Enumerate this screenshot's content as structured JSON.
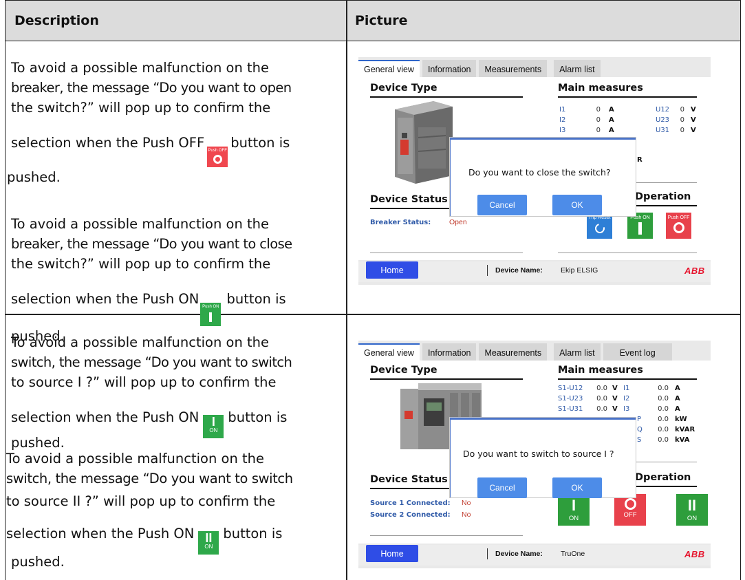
{
  "table": {
    "header": {
      "description": "Description",
      "picture": "Picture"
    }
  },
  "row1": {
    "para1": {
      "l1": "To avoid a possible malfunction on the",
      "l2": "breaker, the message “Do you want to open",
      "l3": "the switch?” will pop up to confirm the",
      "l4a": "selection when the Push OFF",
      "l4b": "button is",
      "l5": "pushed.",
      "btn_label": "Push OFF"
    },
    "para2": {
      "l1": "To avoid a possible malfunction on the",
      "l2": "breaker, the message “Do you want to close",
      "l3": "the switch?” will pop up to confirm the",
      "l4a": "selection when the Push ON",
      "l4b": "button is",
      "l5": "pushed.",
      "btn_label": "Push ON"
    },
    "screen": {
      "tabs": [
        "General view",
        "Information",
        "Measurements",
        "Alarm list"
      ],
      "device_type": "Device Type",
      "main_measures": "Main measures",
      "measures": [
        {
          "label": "I1",
          "value": "0",
          "unit": "A"
        },
        {
          "label": "I2",
          "value": "0",
          "unit": "A"
        },
        {
          "label": "I3",
          "value": "0",
          "unit": "A"
        }
      ],
      "measures_right": [
        {
          "label": "U12",
          "value": "0",
          "unit": "V"
        },
        {
          "label": "U23",
          "value": "0",
          "unit": "V"
        },
        {
          "label": "U31",
          "value": "0",
          "unit": "V"
        }
      ],
      "partial_r": "R",
      "device_status": "Device Status",
      "operation": "Operation",
      "operation_visible": "Dperation",
      "breaker_status_label": "Breaker Status:",
      "breaker_status_value": "Open",
      "trip_reset_label": "Trip Reset",
      "push_on_label": "Push ON",
      "push_off_label": "Push OFF",
      "dialog_text": "Do you want to close the switch?",
      "cancel": "Cancel",
      "ok": "OK",
      "home": "Home",
      "device_name_label": "Device Name:",
      "device_name_value": "Ekip ELSIG",
      "logo": "ABB"
    }
  },
  "row2": {
    "para1": {
      "l1": "To avoid a possible malfunction on the",
      "l2": "switch, the message “Do you want to switch",
      "l3": "to source Ι ?” will pop up to confirm the",
      "l4a": "selection when the Push ON",
      "l4b": "button is",
      "l5": "pushed.",
      "btn_symbol": "I",
      "btn_sub": "ON"
    },
    "para2": {
      "l1": "To avoid a possible malfunction on the",
      "l2": "switch, the message “Do you want to switch",
      "l3": "to source II ?” will pop up to confirm the",
      "l4a": "selection when the Push ON",
      "l4b": "button is",
      "l5": "pushed.",
      "btn_symbol": "II",
      "btn_sub": "ON"
    },
    "screen": {
      "tabs": [
        "General view",
        "Information",
        "Measurements",
        "Alarm list",
        "Event log"
      ],
      "device_type": "Device Type",
      "main_measures": "Main measures",
      "measures_left": [
        {
          "label": "S1-U12",
          "value": "0.0",
          "unit": "V"
        },
        {
          "label": "S1-U23",
          "value": "0.0",
          "unit": "V"
        },
        {
          "label": "S1-U31",
          "value": "0.0",
          "unit": "V"
        }
      ],
      "measures_right": [
        {
          "label": "I1",
          "value": "0.0",
          "unit": "A"
        },
        {
          "label": "I2",
          "value": "0.0",
          "unit": "A"
        },
        {
          "label": "I3",
          "value": "0.0",
          "unit": "A"
        },
        {
          "label": "P",
          "value": "0.0",
          "unit": "kW"
        },
        {
          "label": "Q",
          "value": "0.0",
          "unit": "kVAR"
        },
        {
          "label": "S",
          "value": "0.0",
          "unit": "kVA"
        }
      ],
      "device_status": "Device Status",
      "operation_visible": "Dperation",
      "source1_label": "Source 1 Connected:",
      "source1_value": "No",
      "source2_label": "Source 2 Connected:",
      "source2_value": "No",
      "btn_on1_symbol": "I",
      "btn_on1_label": "ON",
      "btn_off_label": "OFF",
      "btn_on2_symbol": "II",
      "btn_on2_label": "ON",
      "dialog_text": "Do you want to switch to source Ι ?",
      "cancel": "Cancel",
      "ok": "OK",
      "home": "Home",
      "device_name_label": "Device Name:",
      "device_name_value": "TruOne",
      "logo": "ABB"
    }
  }
}
